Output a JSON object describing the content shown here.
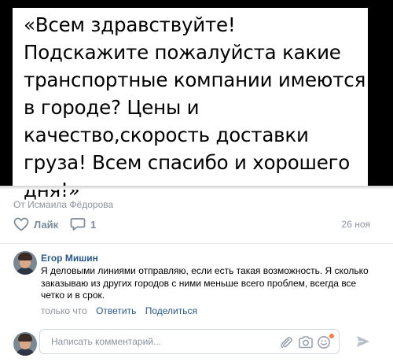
{
  "post": {
    "image_text": "«Всем здравствуйте! Подскажите пожалуйста какие транспортные компании имеются в городе? Цены и качество,скорость доставки груза! Всем спасибо и хорошего дня!»",
    "author_line": "От Исмаила Фёдорова",
    "like_label": "Лайк",
    "comment_count": "1",
    "date": "26 ноя"
  },
  "comment": {
    "author": "Егор Мишин",
    "text": "Я деловыми линиями отправляю, если есть такая возможность. Я сколько заказываю из других городов с ними меньше всего проблем, всегда все четко и в срок.",
    "time": "только что",
    "reply_label": "Ответить",
    "share_label": "Поделиться"
  },
  "composer": {
    "placeholder": "Написать комментарий..."
  },
  "icons": {
    "like": "heart-icon",
    "comment": "comment-bubble-icon",
    "attach": "paperclip-icon",
    "camera": "camera-icon",
    "emoji": "emoji-icon",
    "send": "send-icon"
  },
  "colors": {
    "link": "#2a5885",
    "muted": "#8b939c",
    "emoji_dot": "#ff7a45"
  }
}
